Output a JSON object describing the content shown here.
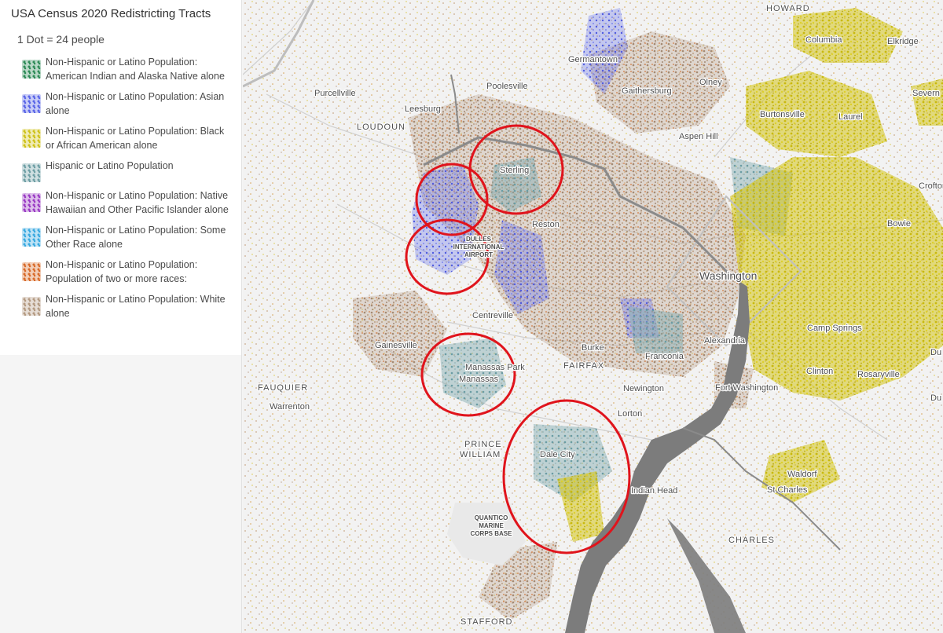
{
  "legend": {
    "title": "USA Census 2020 Redistricting Tracts",
    "scale": "1 Dot = 24 people",
    "items": [
      {
        "label": "Non-Hispanic or Latino Population: American Indian and Alaska Native alone",
        "color": "#2e8b57",
        "icon": "dots-swatch"
      },
      {
        "label": "Non-Hispanic or Latino Population: Asian alone",
        "color": "#5a66e8",
        "icon": "dots-swatch"
      },
      {
        "label": "Non-Hispanic or Latino Population: Black or African American alone",
        "color": "#cfc21a",
        "icon": "dots-swatch"
      },
      {
        "label": "Hispanic or Latino Population",
        "color": "#6f9fa5",
        "icon": "dots-swatch"
      },
      {
        "label": "Non-Hispanic or Latino Population: Native Hawaiian and Other Pacific Islander alone",
        "color": "#9a3bc4",
        "icon": "dots-swatch"
      },
      {
        "label": "Non-Hispanic or Latino Population: Some Other Race alone",
        "color": "#3aa9e0",
        "icon": "dots-swatch"
      },
      {
        "label": "Non-Hispanic or Latino Population: Population of two or more races:",
        "color": "#d86b2b",
        "icon": "dots-swatch"
      },
      {
        "label": "Non-Hispanic or Latino Population: White alone",
        "color": "#b49a82",
        "icon": "dots-swatch"
      }
    ]
  },
  "map": {
    "highlight_color": "#e0141c",
    "water_color": "#7c7c7c",
    "places": {
      "howard": "HOWARD",
      "columbia": "Columbia",
      "elkridge": "Elkridge",
      "germantown": "Germantown",
      "olney": "Olney",
      "poolesville": "Poolesville",
      "gaithersburg": "Gaithersburg",
      "purcellville": "Purcellville",
      "leesburg": "Leesburg",
      "loudoun": "LOUDOUN",
      "burtonsville": "Burtonsville",
      "laurel": "Laurel",
      "severn": "Severn",
      "aspen_hill": "Aspen Hill",
      "sterling": "Sterling",
      "crofton": "Crofton",
      "reston": "Reston",
      "bowie": "Bowie",
      "dulles_1": "DULLES",
      "dulles_2": "INTERNATIONAL",
      "dulles_3": "AIRPORT",
      "washington": "Washington",
      "centreville": "Centreville",
      "camp_springs": "Camp Springs",
      "alexandria": "Alexandria",
      "gainesville": "Gainesville",
      "burke": "Burke",
      "franconia": "Franconia",
      "manassas_park": "Manassas Park",
      "manassas": "Manassas",
      "fairfax": "FAIRFAX",
      "clinton": "Clinton",
      "rosaryville": "Rosaryville",
      "fauquier": "FAUQUIER",
      "newington": "Newington",
      "fort_washington": "Fort Washington",
      "warrenton": "Warrenton",
      "lorton": "Lorton",
      "prince": "PRINCE",
      "william": "WILLIAM",
      "dale_city": "Dale City",
      "waldorf": "Waldorf",
      "st_charles": "St Charles",
      "indian_head": "Indian Head",
      "quantico_1": "QUANTICO",
      "quantico_2": "MARINE",
      "quantico_3": "CORPS BASE",
      "charles": "CHARLES",
      "stafford": "STAFFORD",
      "du_1": "Du",
      "du_2": "Du"
    }
  }
}
